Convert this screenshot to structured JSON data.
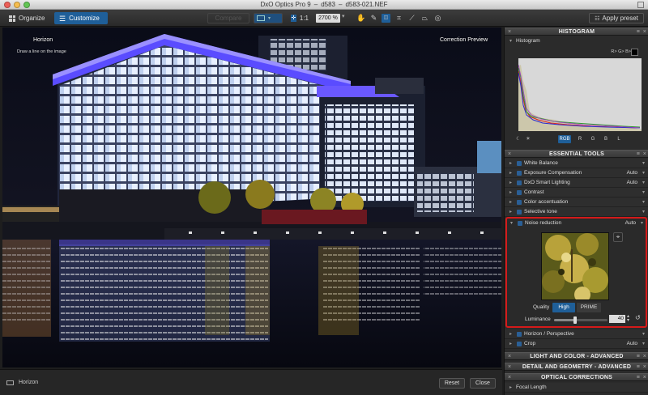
{
  "window": {
    "title_app": "DxO Optics Pro 9",
    "title_sep": "–",
    "title_folder": "d583",
    "title_file": "d583-021.NEF",
    "traffic_colors": [
      "#ec5f58",
      "#f5bd4f",
      "#62c554"
    ]
  },
  "toolbar": {
    "tabs": [
      {
        "label": "Organize",
        "icon": "grid-icon",
        "active": false
      },
      {
        "label": "Customize",
        "icon": "sliders-icon",
        "active": true
      }
    ],
    "compare_label": "Compare",
    "zoom_ratio_label": "1:1",
    "zoom_value": "2700 %",
    "tool_icons": [
      "hand-icon",
      "eyedropper-icon",
      "white-balance-icon",
      "crop-icon",
      "horizon-icon",
      "perspective-icon",
      "red-eye-icon"
    ],
    "apply_preset_label": "Apply preset"
  },
  "viewer": {
    "left_label": "Horizon",
    "hint": "Draw a line on the image",
    "right_label": "Correction Preview"
  },
  "bottombar": {
    "tool_label": "Horizon",
    "reset_label": "Reset",
    "close_label": "Close"
  },
  "panel": {
    "histogram": {
      "header": "HISTOGRAM",
      "sub_label": "Histogram",
      "rgb_toggle": "R> G> B>",
      "modes": [
        "RGB",
        "R",
        "G",
        "B",
        "L"
      ],
      "selected_mode": "RGB",
      "accent": "#1f5f99"
    },
    "essential": {
      "header": "ESSENTIAL TOOLS",
      "items": [
        {
          "label": "White Balance",
          "value": ""
        },
        {
          "label": "Exposure Compensation",
          "value": "Auto"
        },
        {
          "label": "DxO Smart Lighting",
          "value": "Auto"
        },
        {
          "label": "Contrast",
          "value": ""
        },
        {
          "label": "Color accentuation",
          "value": ""
        },
        {
          "label": "Selective tone",
          "value": ""
        }
      ]
    },
    "noise_reduction": {
      "label": "Noise reduction",
      "value": "Auto",
      "quality_label": "Quality",
      "quality_options": [
        "High",
        "PRIME"
      ],
      "quality_selected": "High",
      "luminance_label": "Luminance",
      "luminance_value": "40",
      "luminance_level_pct": 40,
      "highlight_color": "#d51a1a"
    },
    "after_items": [
      {
        "label": "Horizon / Perspective",
        "value": ""
      },
      {
        "label": "Crop",
        "value": "Auto"
      }
    ],
    "sections": [
      "LIGHT AND COLOR - ADVANCED",
      "DETAIL AND GEOMETRY - ADVANCED",
      "OPTICAL CORRECTIONS"
    ],
    "last_item": "Focal Length"
  }
}
